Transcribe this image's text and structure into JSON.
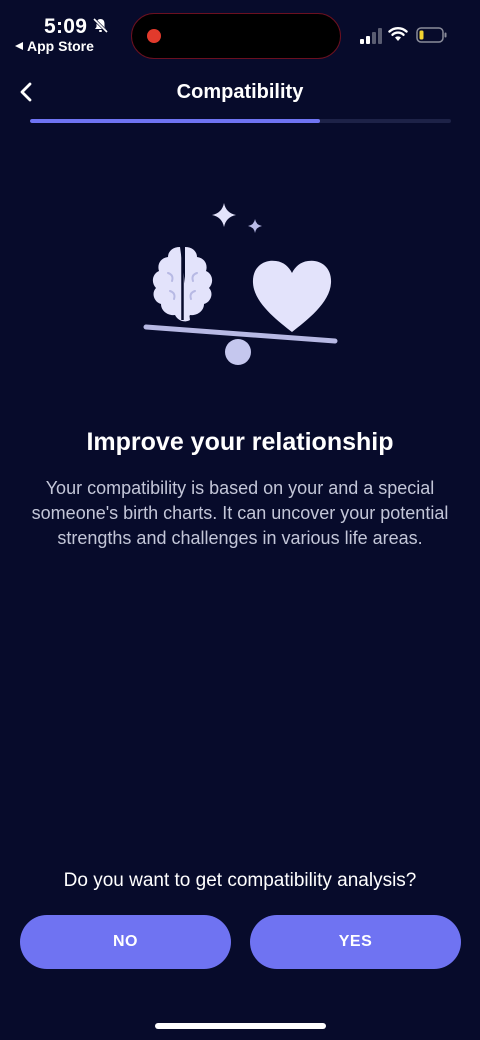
{
  "status_bar": {
    "time": "5:09",
    "back_app_label": "App Store",
    "icons": [
      "bell-off-icon",
      "signal-icon",
      "wifi-icon",
      "battery-icon"
    ]
  },
  "nav": {
    "title": "Compatibility",
    "back_icon": "chevron-left-icon"
  },
  "progress": {
    "fraction": 0.69
  },
  "illustration": {
    "icons": [
      "sparkle-icon",
      "brain-icon",
      "heart-icon",
      "balance-scale-icon"
    ]
  },
  "content": {
    "headline": "Improve your relationship",
    "description": "Your compatibility is based on your and a special someone's birth charts. It can uncover your potential strengths and challenges in various life areas."
  },
  "footer": {
    "question": "Do you want to get compatibility analysis?",
    "no_label": "NO",
    "yes_label": "YES"
  },
  "colors": {
    "background": "#070b2b",
    "accent": "#6f73f2",
    "illustration": "#e3e3fb",
    "text_secondary": "#c3c6d8"
  }
}
